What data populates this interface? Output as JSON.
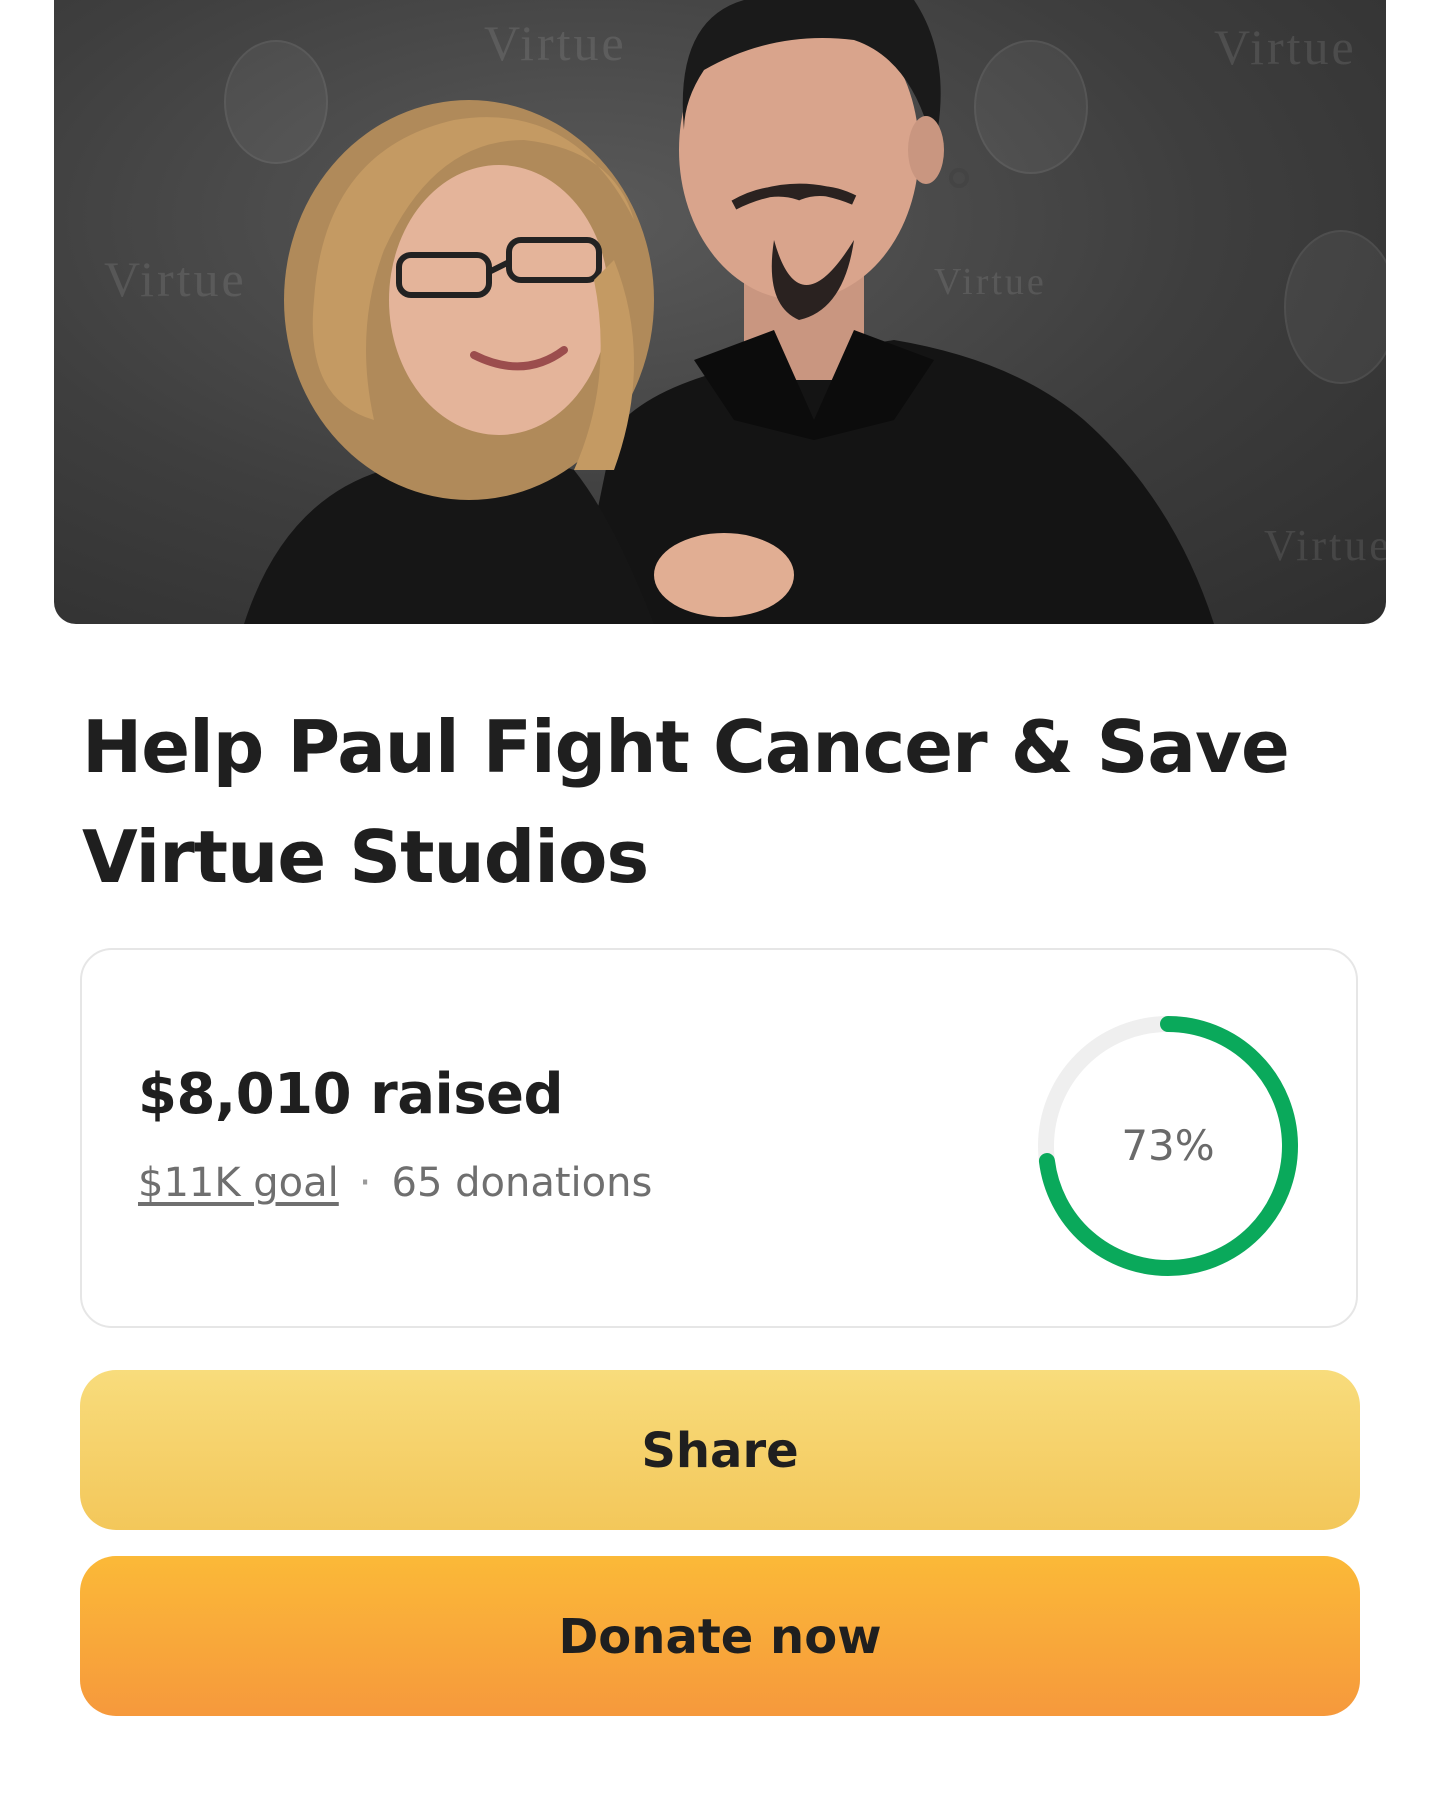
{
  "campaign": {
    "title": "Help Paul Fight Cancer & Save Virtue Studios",
    "photo": {
      "alt": "Couple posing in front of a Virtue Studios backdrop",
      "watermark_text": "Virtue"
    }
  },
  "stats": {
    "amount": "$8,010",
    "raised_suffix": "raised",
    "goal_label": "$11K goal",
    "separator": "·",
    "donations_label": "65 donations",
    "progress_label": "73%",
    "progress_fraction": 0.73
  },
  "buttons": {
    "share": "Share",
    "donate": "Donate now"
  },
  "colors": {
    "progress": "#0aa95b",
    "progress_track": "#efefef",
    "share_bg": "#f6d36c",
    "donate_bg": "#f8a83a"
  },
  "icons": {
    "progress": "circular-progress-ring"
  }
}
